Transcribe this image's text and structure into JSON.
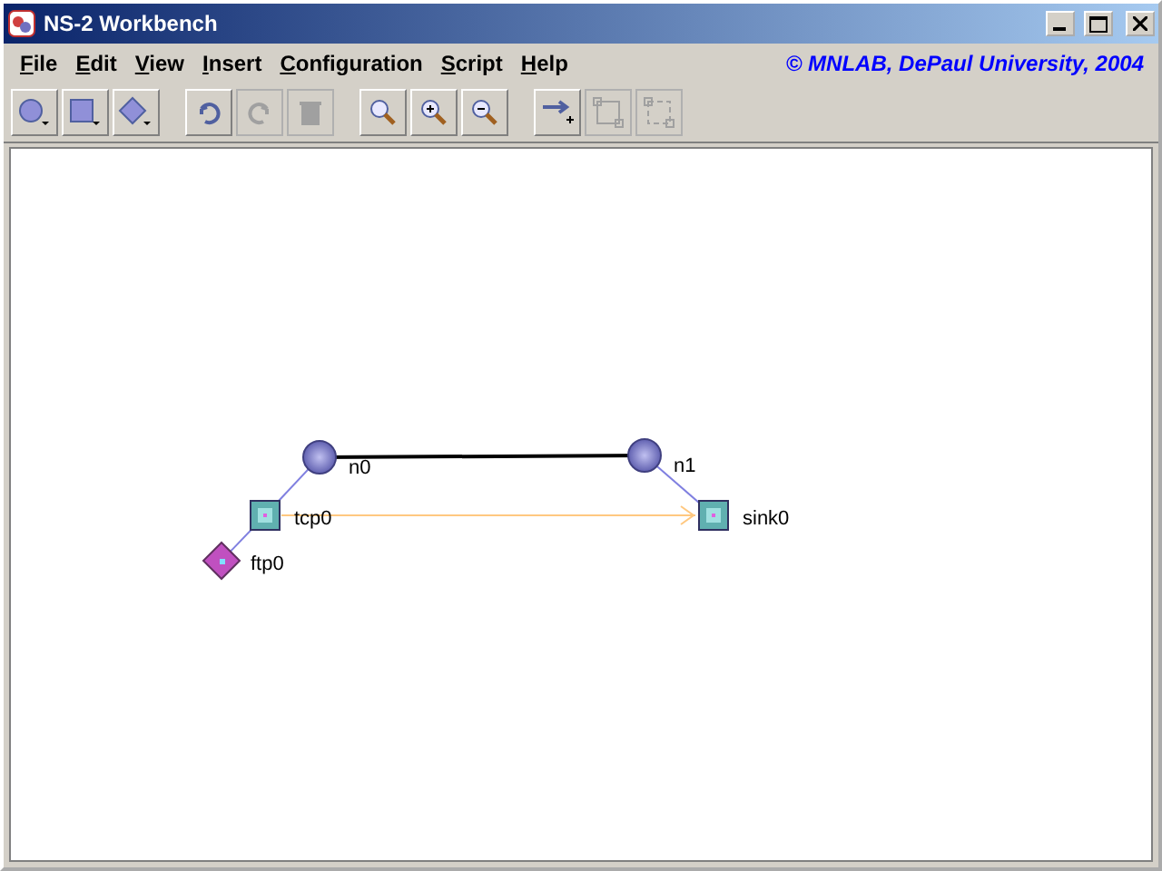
{
  "window": {
    "title": "NS-2 Workbench"
  },
  "menu": [
    "File",
    "Edit",
    "View",
    "Insert",
    "Configuration",
    "Script",
    "Help"
  ],
  "credit": "© MNLAB, DePaul University, 2004",
  "toolbar": [
    {
      "kind": "circle",
      "disabled": false
    },
    {
      "kind": "square",
      "disabled": false
    },
    {
      "kind": "diamond",
      "disabled": false
    },
    {
      "kind": "undo",
      "disabled": false
    },
    {
      "kind": "redo",
      "disabled": true
    },
    {
      "kind": "delete",
      "disabled": true
    },
    {
      "kind": "zoom",
      "disabled": false
    },
    {
      "kind": "zoom-in",
      "disabled": false
    },
    {
      "kind": "zoom-out",
      "disabled": false
    },
    {
      "kind": "link",
      "disabled": false
    },
    {
      "kind": "group",
      "disabled": true
    },
    {
      "kind": "ungroup",
      "disabled": true
    }
  ],
  "nodes": [
    {
      "kind": "node",
      "label": "n0"
    },
    {
      "kind": "node",
      "label": "n1"
    },
    {
      "kind": "agent",
      "label": "tcp0"
    },
    {
      "kind": "agent",
      "label": "sink0"
    },
    {
      "kind": "app",
      "label": "ftp0"
    }
  ]
}
